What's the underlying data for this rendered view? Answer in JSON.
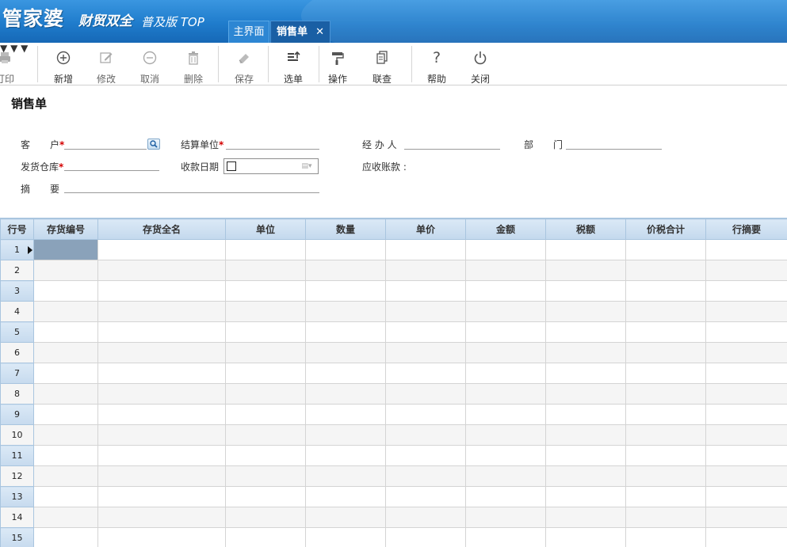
{
  "header": {
    "logo_main": "管家婆",
    "logo_sub": "财贸双全",
    "logo_version": "普及版 TOP",
    "tabs": [
      {
        "label": "主界面"
      },
      {
        "label": "销售单",
        "close": "✕"
      }
    ]
  },
  "toolbar": {
    "print": "打印",
    "add": "新增",
    "edit": "修改",
    "cancel": "取消",
    "delete": "删除",
    "save": "保存",
    "select": "选单",
    "operate": "操作",
    "link": "联查",
    "help": "帮助",
    "close": "关闭"
  },
  "form": {
    "title": "销售单",
    "customer_label_a": "客",
    "customer_label_b": "户",
    "required_mark": "*",
    "settle_label": "结算单位",
    "handler_label": "经 办 人",
    "dept_label_a": "部",
    "dept_label_b": "门",
    "warehouse_label": "发货仓库",
    "pay_date_label": "收款日期",
    "receivable_label": "应收账款 :",
    "summary_label_a": "摘",
    "summary_label_b": "要"
  },
  "grid": {
    "columns": [
      "行号",
      "存货编号",
      "存货全名",
      "单位",
      "数量",
      "单价",
      "金额",
      "税额",
      "价税合计",
      "行摘要"
    ],
    "rows": [
      "1",
      "2",
      "3",
      "4",
      "5",
      "6",
      "7",
      "8",
      "9",
      "10",
      "11",
      "12",
      "13",
      "14",
      "15"
    ]
  },
  "colors": {
    "header_blue": "#1f7ccc",
    "grid_header": "#c3d8ed",
    "selected_cell": "#8aa2ba",
    "required": "#d40000"
  }
}
